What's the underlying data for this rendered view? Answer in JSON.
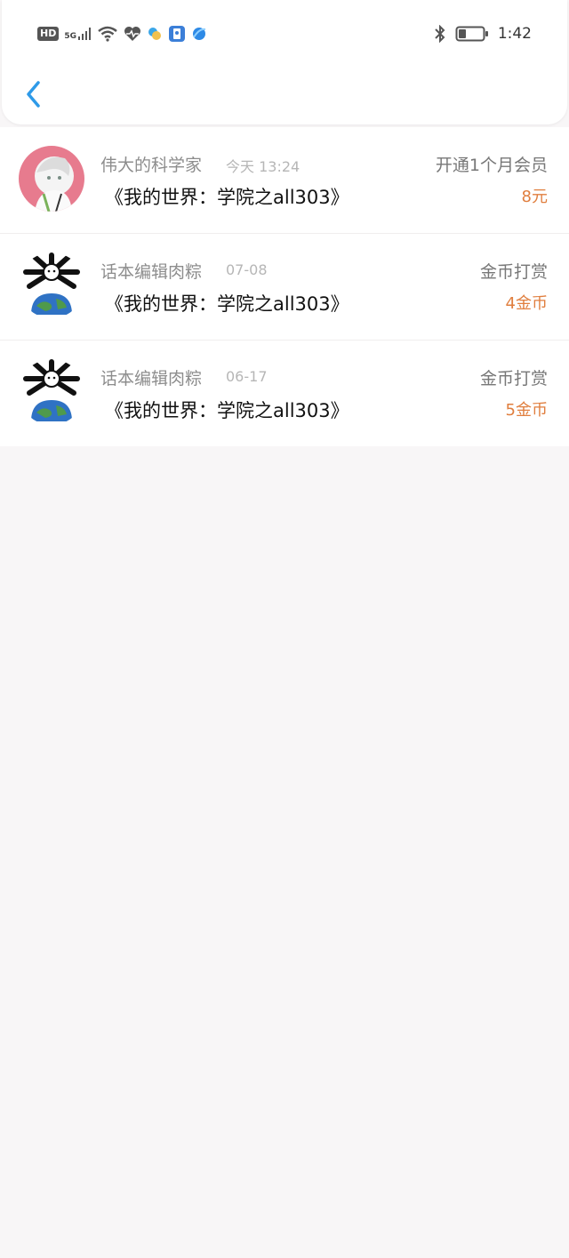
{
  "status_bar": {
    "hd": "HD",
    "network": "5G",
    "time": "1:42",
    "icons": [
      "hd-icon",
      "signal-icon",
      "wifi-icon",
      "heart-rate-icon",
      "app-icon",
      "app-icon-blue",
      "browser-icon",
      "bluetooth-icon",
      "battery-icon"
    ]
  },
  "nav": {
    "back_icon": "chevron-left-icon"
  },
  "records": [
    {
      "name": "伟大的科学家",
      "date": "今天 13:24",
      "title": "《我的世界：学院之all303》",
      "kind": "开通1个月会员",
      "amount": "8元",
      "avatar": "anime-avatar"
    },
    {
      "name": "话本编辑肉粽",
      "date": "07-08",
      "title": "《我的世界：学院之all303》",
      "kind": "金币打赏",
      "amount": "4金币",
      "avatar": "bones-earth-avatar"
    },
    {
      "name": "话本编辑肉粽",
      "date": "06-17",
      "title": "《我的世界：学院之all303》",
      "kind": "金币打赏",
      "amount": "5金币",
      "avatar": "bones-earth-avatar"
    }
  ],
  "colors": {
    "accent": "#2e9ae8",
    "amount": "#e07e3e",
    "background": "#f8f6f7"
  }
}
